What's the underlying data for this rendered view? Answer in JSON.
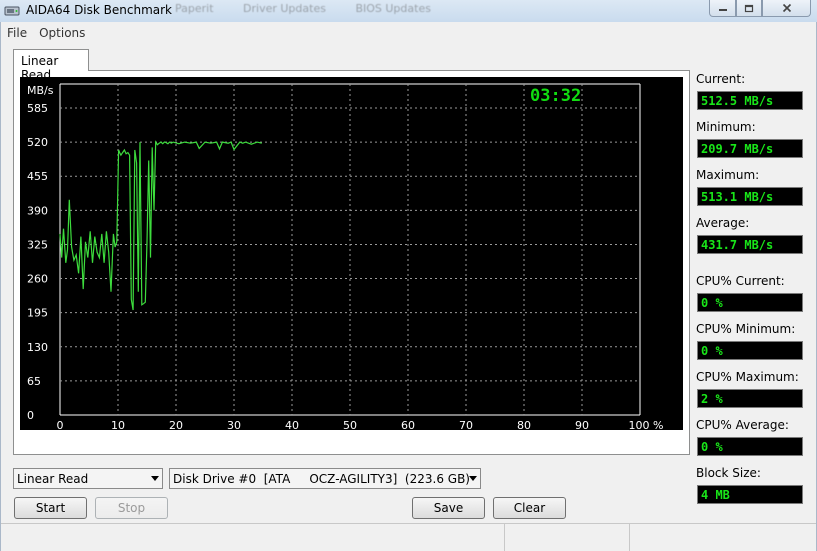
{
  "window": {
    "title": "AIDA64 Disk Benchmark",
    "background_tabs": [
      "Paperit",
      "Driver Updates",
      "BIOS Updates"
    ]
  },
  "menu": [
    "File",
    "Options"
  ],
  "tab": {
    "label": "Linear Read"
  },
  "chart_data": {
    "type": "line",
    "ylabel": "MB/s",
    "y_ticks": [
      "585",
      "520",
      "455",
      "390",
      "325",
      "260",
      "195",
      "130",
      "65",
      "0"
    ],
    "x_ticks": [
      "0",
      "10",
      "20",
      "30",
      "40",
      "50",
      "60",
      "70",
      "80",
      "90",
      "100 %"
    ],
    "xlim": [
      0,
      100
    ],
    "ylim": [
      0,
      585
    ],
    "grid": true,
    "timer": "03:32",
    "line_color": "#3ddc3d",
    "series": [
      {
        "x": [
          0,
          0.3,
          0.6,
          1,
          1.3,
          1.6,
          2,
          2.4,
          2.8,
          3.2,
          3.6,
          4,
          4.4,
          4.8,
          5.2,
          5.6,
          6,
          6.4,
          6.8,
          7.2,
          7.6,
          8,
          8.4,
          8.8,
          9.2,
          9.5,
          9.8,
          10.1,
          10.3,
          10.5,
          10.8,
          11.1,
          11.4,
          11.7,
          12,
          12.3,
          12.6,
          12.9,
          13.2,
          13.5,
          13.8,
          14.1,
          14.4,
          14.7,
          15,
          15.3,
          15.6,
          15.9,
          16.2,
          16.5,
          16.8,
          17.1,
          17.4,
          17.7,
          18,
          18.3,
          18.6,
          18.9,
          19.2,
          19.5,
          19.8,
          20.5,
          21.5,
          22.5,
          23.5,
          24,
          25,
          26,
          27,
          27.5,
          28,
          29,
          29.5,
          30,
          31,
          31.5,
          32,
          33,
          34,
          34.8
        ],
        "y": [
          345,
          300,
          355,
          290,
          315,
          410,
          320,
          295,
          305,
          270,
          340,
          240,
          330,
          300,
          350,
          290,
          340,
          310,
          300,
          345,
          290,
          350,
          310,
          235,
          345,
          320,
          330,
          505,
          500,
          495,
          500,
          505,
          498,
          500,
          495,
          220,
          200,
          505,
          480,
          235,
          520,
          210,
          212,
          215,
          330,
          485,
          300,
          510,
          390,
          520,
          515,
          518,
          520,
          517,
          520,
          519,
          517,
          520,
          518,
          520,
          519,
          517,
          520,
          518,
          520,
          508,
          520,
          518,
          520,
          507,
          520,
          518,
          520,
          506,
          520,
          518,
          520,
          516,
          520,
          518
        ]
      }
    ]
  },
  "stats": {
    "current_label": "Current:",
    "current_value": "512.5 MB/s",
    "minimum_label": "Minimum:",
    "minimum_value": "209.7 MB/s",
    "maximum_label": "Maximum:",
    "maximum_value": "513.1 MB/s",
    "average_label": "Average:",
    "average_value": "431.7 MB/s",
    "cpu_current_label": "CPU% Current:",
    "cpu_current_value": "0 %",
    "cpu_minimum_label": "CPU% Minimum:",
    "cpu_minimum_value": "0 %",
    "cpu_maximum_label": "CPU% Maximum:",
    "cpu_maximum_value": "2 %",
    "cpu_average_label": "CPU% Average:",
    "cpu_average_value": "0 %",
    "block_size_label": "Block Size:",
    "block_size_value": "4 MB"
  },
  "controls": {
    "test_select": "Linear Read",
    "drive_select": "Disk Drive #0  [ATA     OCZ-AGILITY3]  (223.6 GB)",
    "start_label": "Start",
    "stop_label": "Stop",
    "save_label": "Save",
    "clear_label": "Clear"
  }
}
